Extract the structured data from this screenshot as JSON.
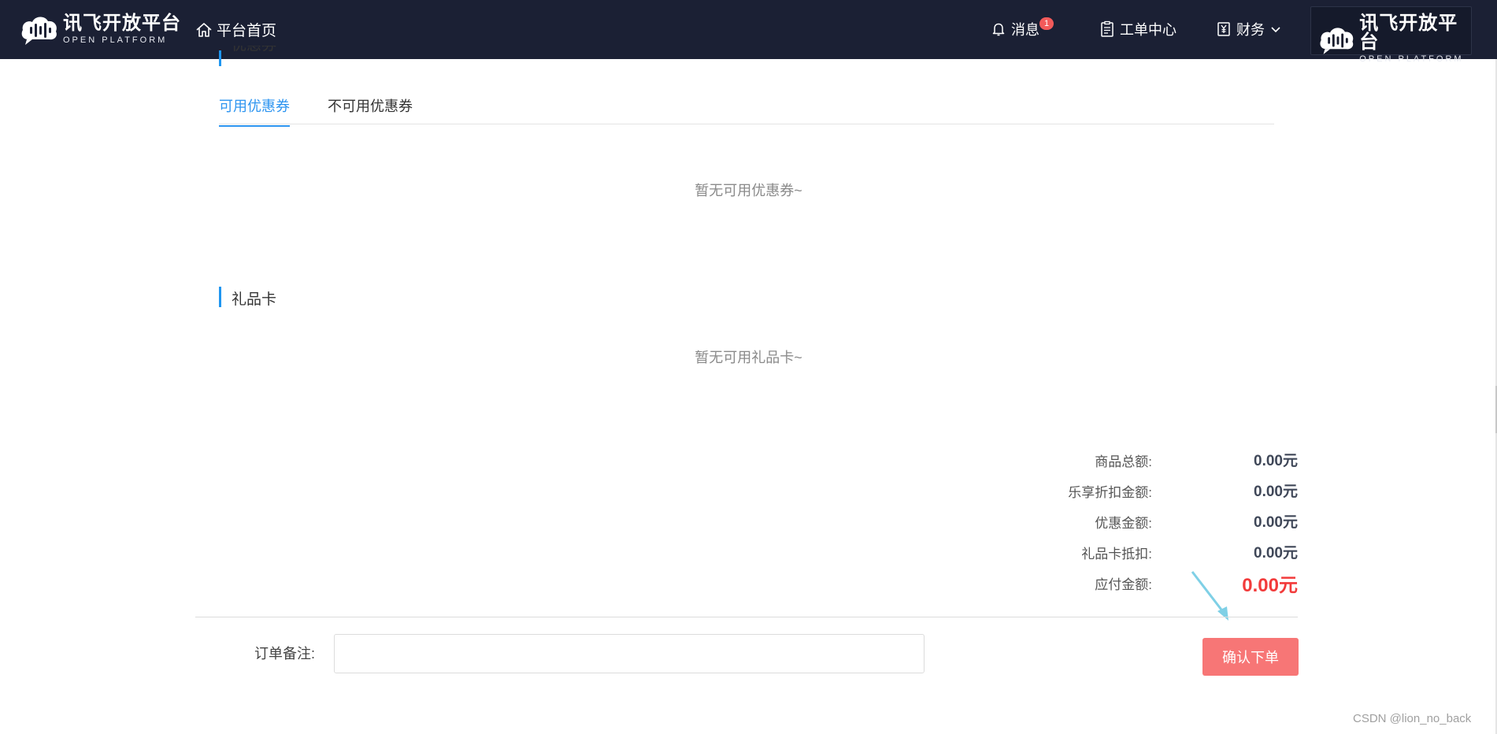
{
  "header": {
    "logo": {
      "cn": "讯飞开放平台",
      "en": "OPEN PLATFORM"
    },
    "home_label": "平台首页",
    "messages_label": "消息",
    "messages_badge": "1",
    "ticket_label": "工单中心",
    "finance_label": "财务"
  },
  "coupon_section": {
    "title": "优惠券",
    "tabs": [
      {
        "label": "可用优惠券",
        "active": true
      },
      {
        "label": "不可用优惠券",
        "active": false
      }
    ],
    "empty_text": "暂无可用优惠券~"
  },
  "giftcard_section": {
    "title": "礼品卡",
    "empty_text": "暂无可用礼品卡~"
  },
  "summary": {
    "rows": [
      {
        "label": "商品总额:",
        "value": "0.00元"
      },
      {
        "label": "乐享折扣金额:",
        "value": "0.00元"
      },
      {
        "label": "优惠金额:",
        "value": "0.00元"
      },
      {
        "label": "礼品卡抵扣:",
        "value": "0.00元"
      },
      {
        "label": "应付金额:",
        "value": "0.00元"
      }
    ]
  },
  "order": {
    "remark_label": "订单备注:",
    "remark_value": "",
    "confirm_label": "确认下单"
  },
  "watermark": "CSDN @lion_no_back",
  "colors": {
    "header_bg": "#1b2034",
    "accent": "#2e95f0",
    "total_price": "#f23b3b",
    "confirm_button": "#f77676",
    "annotation_arrow": "#7fd0e6"
  }
}
